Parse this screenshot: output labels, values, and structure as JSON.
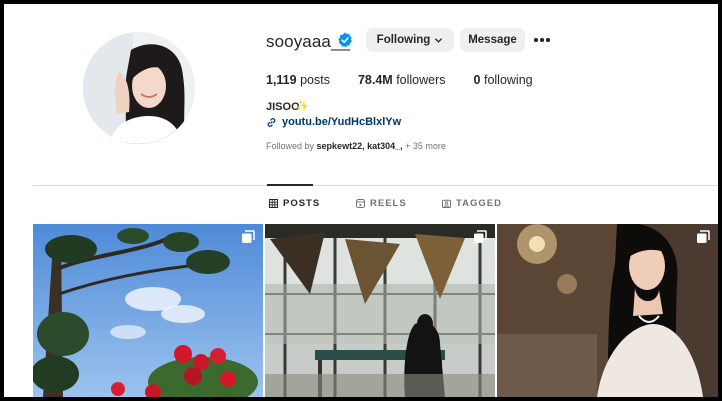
{
  "profile": {
    "username": "sooyaaa__",
    "full_name": "JISOO",
    "link": "youtu.be/YudHcBlxlYw",
    "verified_icon": "verified-badge-icon",
    "sparkle_icon": "sparkle-emoji-icon",
    "link_icon": "link-icon"
  },
  "actions": {
    "following_label": "Following",
    "message_label": "Message",
    "more_icon": "more-options-icon",
    "chevron_icon": "chevron-down-icon"
  },
  "stats": {
    "posts_count": "1,119",
    "posts_label": "posts",
    "followers_count": "78.4M",
    "followers_label": "followers",
    "following_count": "0",
    "following_label": "following"
  },
  "followed_by": {
    "prefix": "Followed by",
    "names": "sepkewt22, kat304_,",
    "more": "+ 35 more"
  },
  "tabs": [
    {
      "label": "POSTS",
      "icon": "grid-icon",
      "active": true
    },
    {
      "label": "REELS",
      "icon": "reels-icon",
      "active": false
    },
    {
      "label": "TAGGED",
      "icon": "tagged-icon",
      "active": false
    }
  ],
  "posts": [
    {
      "icon": "multiple-photos-icon"
    },
    {
      "icon": "multiple-photos-icon"
    },
    {
      "icon": "multiple-photos-icon"
    }
  ],
  "colors": {
    "text_primary": "#262626",
    "text_secondary": "#737373",
    "link": "#00376b",
    "verified": "#0095f6",
    "button_bg": "#efefef",
    "divider": "#dbdbdb"
  }
}
